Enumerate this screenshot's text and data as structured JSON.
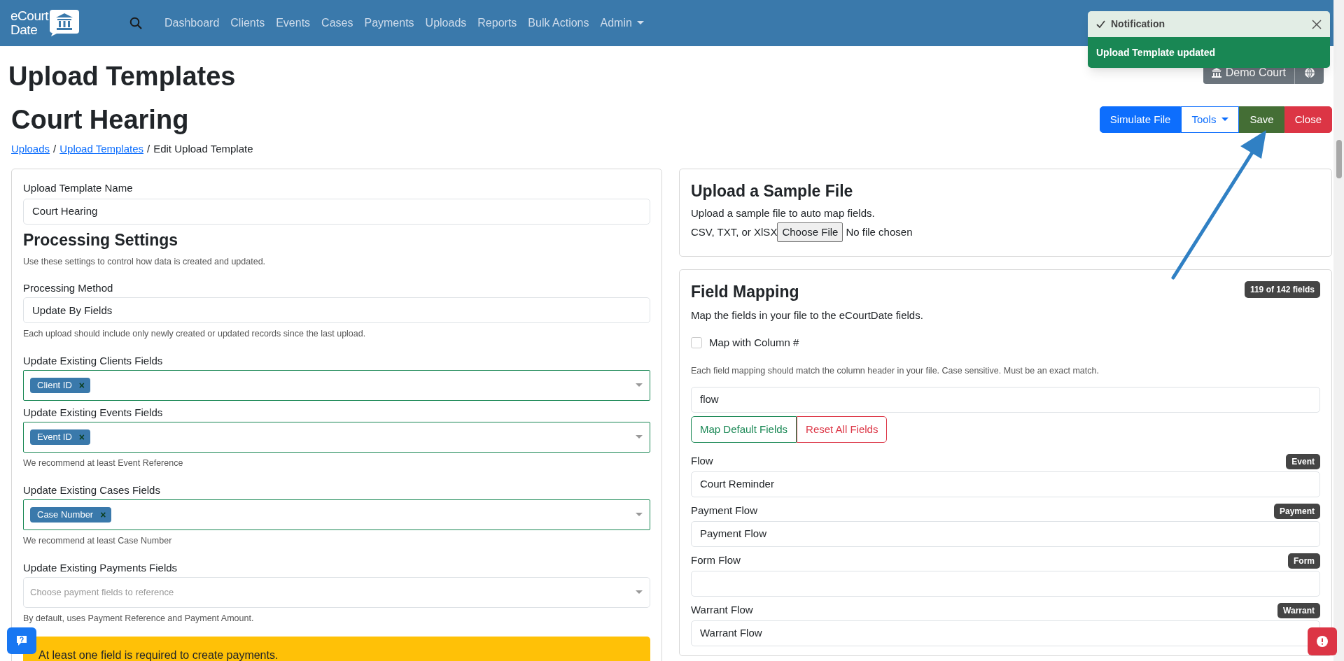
{
  "navbar": {
    "logo_lines": [
      "eCourt",
      "Date"
    ],
    "items": [
      {
        "label": "Dashboard",
        "dropdown": false
      },
      {
        "label": "Clients",
        "dropdown": false
      },
      {
        "label": "Events",
        "dropdown": false
      },
      {
        "label": "Cases",
        "dropdown": false
      },
      {
        "label": "Payments",
        "dropdown": false
      },
      {
        "label": "Uploads",
        "dropdown": false
      },
      {
        "label": "Reports",
        "dropdown": false
      },
      {
        "label": "Bulk Actions",
        "dropdown": false
      },
      {
        "label": "Admin",
        "dropdown": true
      }
    ]
  },
  "page_title": "Upload Templates",
  "court_button": "Demo Court",
  "template_title": "Court Hearing",
  "actions": [
    {
      "label": "Simulate File",
      "kind": "primary",
      "dropdown": false
    },
    {
      "label": "Tools",
      "kind": "outline",
      "dropdown": true
    },
    {
      "label": "Save",
      "kind": "save",
      "dropdown": false
    },
    {
      "label": "Close",
      "kind": "danger",
      "dropdown": false
    }
  ],
  "breadcrumb": [
    {
      "label": "Uploads",
      "kind": "link"
    },
    {
      "label": "/",
      "kind": "separator"
    },
    {
      "label": "Upload Templates",
      "kind": "link"
    },
    {
      "label": "/",
      "kind": "separator"
    },
    {
      "label": "Edit Upload Template",
      "kind": "current"
    }
  ],
  "notification": {
    "title": "Notification",
    "message": "Upload Template updated"
  },
  "settings": {
    "name_label": "Upload Template Name",
    "name_value": "Court Hearing",
    "heading": "Processing Settings",
    "intro": "Use these settings to control how data is created and updated.",
    "fields": [
      {
        "kind": "text",
        "label": "Processing Method",
        "value": "Update By Fields",
        "help": "Each upload should include only newly created or updated records since the last upload."
      },
      {
        "kind": "multiselect",
        "label": "Update Existing Clients Fields",
        "valid": true,
        "tags": [
          {
            "label": "Client ID",
            "remove": "×"
          }
        ]
      },
      {
        "kind": "multiselect",
        "label": "Update Existing Events Fields",
        "valid": true,
        "tags": [
          {
            "label": "Event ID",
            "remove": "×"
          }
        ],
        "help": "We recommend at least Event Reference"
      },
      {
        "kind": "multiselect",
        "label": "Update Existing Cases Fields",
        "valid": true,
        "tags": [
          {
            "label": "Case Number",
            "remove": "×"
          }
        ],
        "help": "We recommend at least Case Number"
      },
      {
        "kind": "multiselect",
        "label": "Update Existing Payments Fields",
        "valid": false,
        "placeholder": "Choose payment fields to reference",
        "help": "By default, uses Payment Reference and Payment Amount."
      }
    ],
    "alert": "At least one field is required to create payments."
  },
  "sample": {
    "title": "Upload a Sample File",
    "text": "Upload a sample file to auto map fields.",
    "accepted": "CSV, TXT, or XlSX",
    "button": "Choose File",
    "status": "No file chosen"
  },
  "mapping": {
    "title": "Field Mapping",
    "count": "119 of 142 fields",
    "text": "Map the fields in your file to the eCourtDate fields.",
    "checkbox": {
      "label": "Map with Column #",
      "checked": false
    },
    "help": "Each field mapping should match the column header in your file. Case sensitive. Must be an exact match.",
    "search": "flow",
    "buttons": [
      {
        "label": "Map Default Fields",
        "kind": "success"
      },
      {
        "label": "Reset All Fields",
        "kind": "danger"
      }
    ],
    "fields": [
      {
        "label": "Flow",
        "badge": "Event",
        "value": "Court Reminder"
      },
      {
        "label": "Payment Flow",
        "badge": "Payment",
        "value": "Payment Flow"
      },
      {
        "label": "Form Flow",
        "badge": "Form"
      },
      {
        "label": "Warrant Flow",
        "badge": "Warrant",
        "value": "Warrant Flow"
      }
    ]
  }
}
